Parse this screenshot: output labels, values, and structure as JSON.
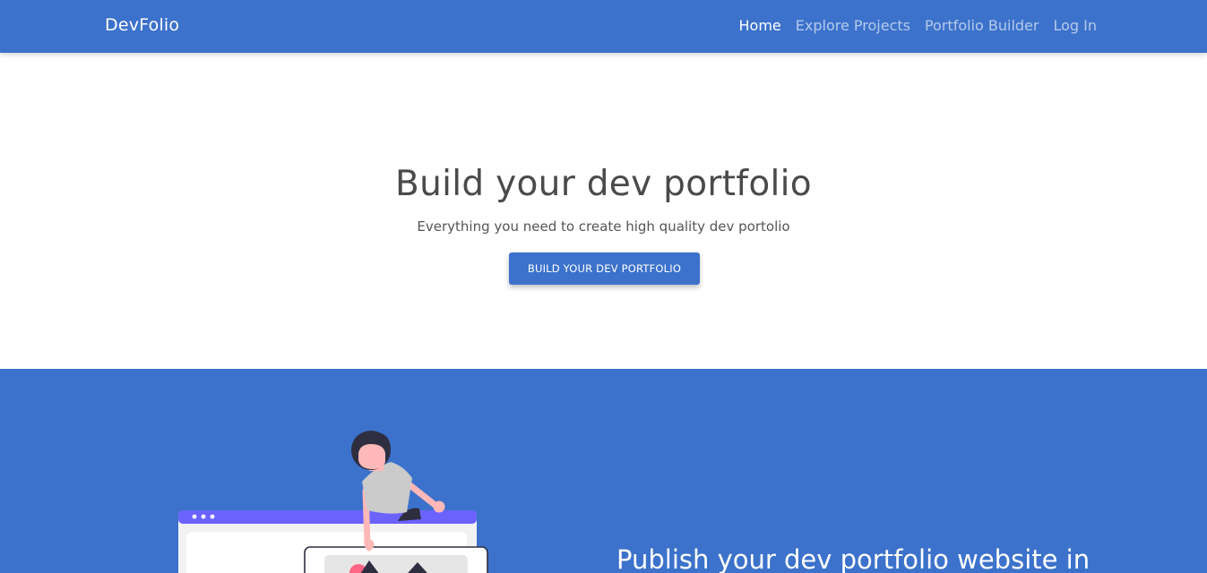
{
  "navbar": {
    "brand": "DevFolio",
    "links": [
      {
        "label": "Home",
        "active": true
      },
      {
        "label": "Explore Projects",
        "active": false
      },
      {
        "label": "Portfolio Builder",
        "active": false
      },
      {
        "label": "Log In",
        "active": false
      }
    ]
  },
  "hero": {
    "title": "Build your dev portfolio",
    "subtitle": "Everything you need to create high quality dev portolio",
    "button_label": "BUILD YOUR DEV PORTFOLIO"
  },
  "feature": {
    "heading": "Publish your dev portfolio website in",
    "illustration_icon": "person-with-browser-window-illustration"
  },
  "colors": {
    "primary": "#3c72cb",
    "browser_bar": "#6c63ff",
    "accent_pink": "#ff6584",
    "dark": "#2f2e41",
    "skin": "#ffb8b8"
  }
}
